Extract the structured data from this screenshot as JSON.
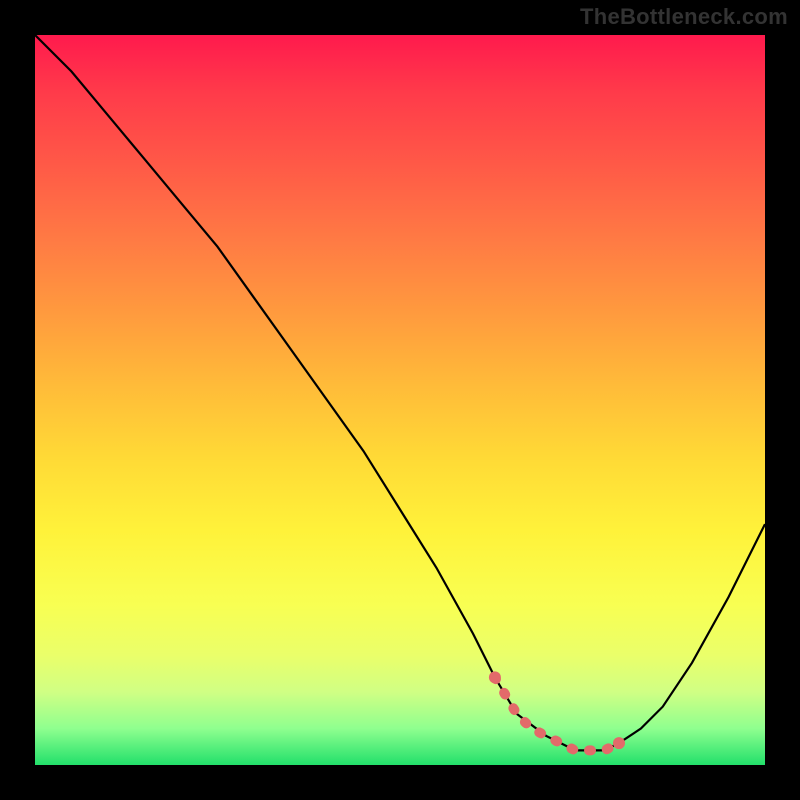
{
  "watermark": "TheBottleneck.com",
  "chart_data": {
    "type": "line",
    "title": "",
    "xlabel": "",
    "ylabel": "",
    "xlim": [
      0,
      100
    ],
    "ylim": [
      0,
      100
    ],
    "grid": false,
    "legend": false,
    "background_gradient": [
      "#ff1a4d",
      "#ff7a44",
      "#ffda36",
      "#f8ff52",
      "#22e06b"
    ],
    "series": [
      {
        "name": "bottleneck-curve",
        "x": [
          0,
          5,
          10,
          15,
          20,
          25,
          30,
          35,
          40,
          45,
          50,
          55,
          60,
          63,
          66,
          70,
          74,
          78,
          80,
          83,
          86,
          90,
          95,
          100
        ],
        "values": [
          100,
          95,
          89,
          83,
          77,
          71,
          64,
          57,
          50,
          43,
          35,
          27,
          18,
          12,
          7,
          4,
          2,
          2,
          3,
          5,
          8,
          14,
          23,
          33
        ],
        "color": "#000000"
      }
    ],
    "markers": {
      "name": "optimal-zone-dots",
      "color": "#e36a6a",
      "x": [
        63,
        66,
        68,
        70,
        72,
        74,
        76,
        78,
        80
      ],
      "values": [
        12,
        7,
        5,
        4,
        3,
        2,
        2,
        2,
        3
      ]
    }
  }
}
